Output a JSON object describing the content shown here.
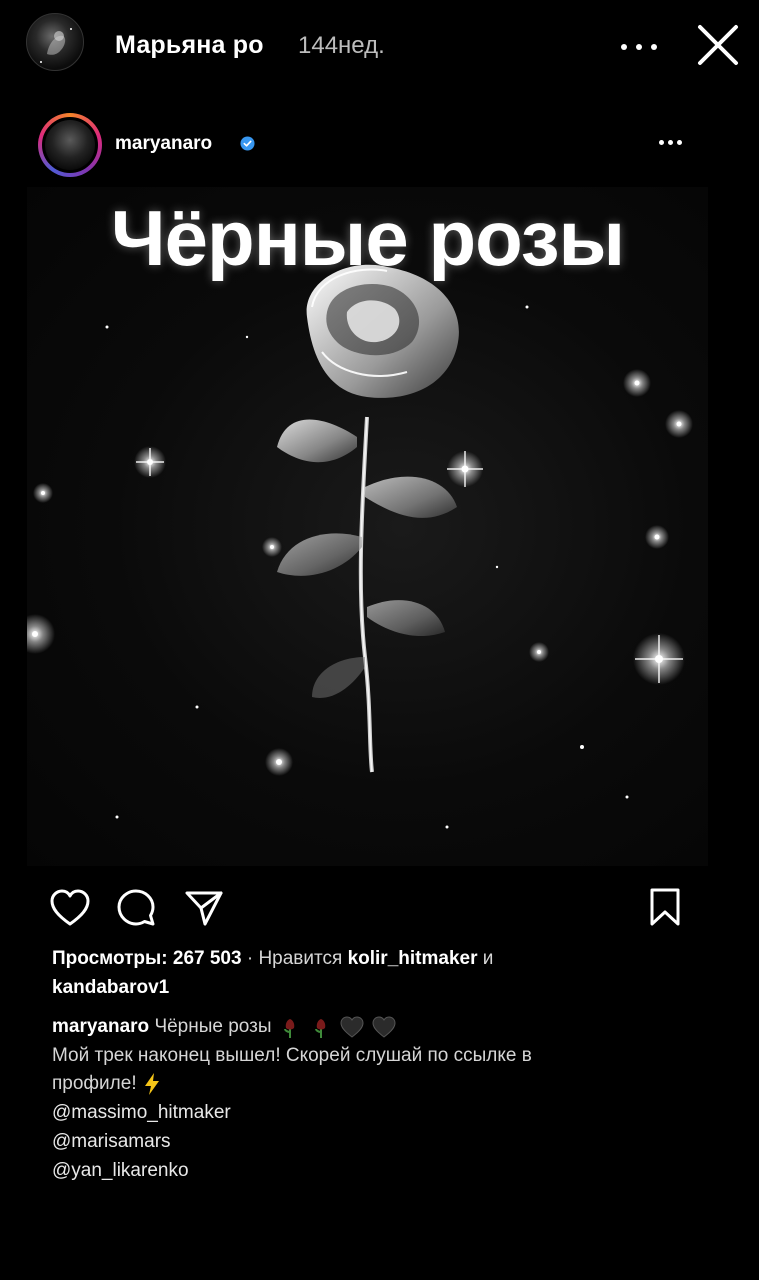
{
  "story": {
    "username": "Марьяна ро",
    "time": "144нед."
  },
  "post": {
    "username": "maryanaro",
    "image_title": "Чёрные розы"
  },
  "stats": {
    "views_label": "Просмотры:",
    "views_count": "267 503",
    "separator": "·",
    "likes_prefix": "Нравится",
    "liked_by_1": "kolir_hitmaker",
    "and": "и",
    "liked_by_2": "kandabarov1"
  },
  "caption": {
    "username": "maryanaro",
    "title": "Чёрные розы",
    "line2": "Мой трек наконец вышел! Скорей слушай по ссылке в",
    "line3": "профиле!",
    "mentions": [
      "@massimo_hitmaker",
      "@marisamars",
      "@yan_likarenko"
    ]
  },
  "icons": {
    "story_more": "more-horizontal-icon",
    "story_close": "close-icon",
    "post_more": "more-horizontal-icon",
    "like": "heart-icon",
    "comment": "comment-bubble-icon",
    "share": "paper-plane-icon",
    "save": "bookmark-icon",
    "verified": "verified-badge-icon"
  },
  "colors": {
    "background": "#000000",
    "verified": "#3897f0",
    "muted_text": "#d6d6d6"
  }
}
